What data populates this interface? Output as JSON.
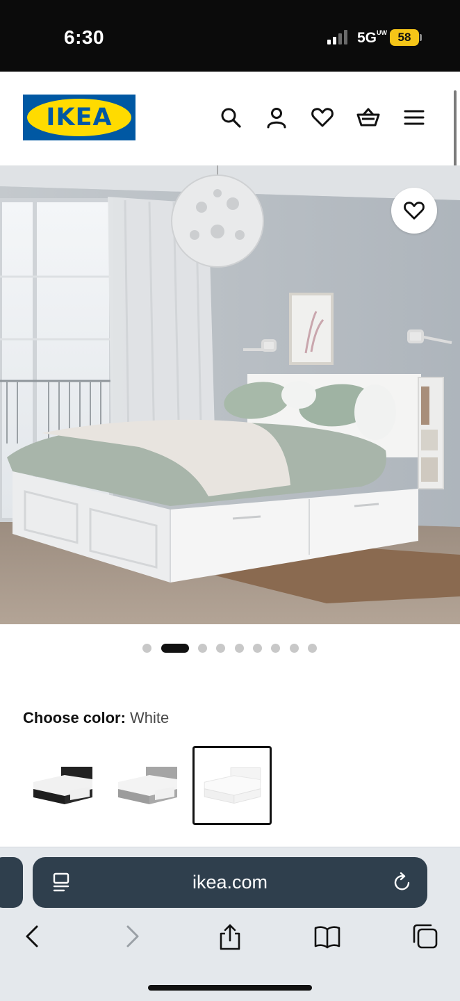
{
  "status_bar": {
    "time": "6:30",
    "network": "5G",
    "network_suffix": "UW",
    "battery": "58",
    "battery_color": "#f5c518"
  },
  "header": {
    "logo_text": "IKEA",
    "logo_colors": {
      "blue": "#0058a3",
      "yellow": "#ffdb00"
    },
    "icons": [
      "search-icon",
      "account-icon",
      "heart-icon",
      "basket-icon",
      "menu-icon"
    ]
  },
  "product": {
    "image_description_icon": "bed-photo",
    "favorite_icon": "heart-icon",
    "carousel": {
      "total": 9,
      "active_index": 1
    },
    "choose_color_label": "Choose color:",
    "selected_color": "White",
    "color_options": [
      {
        "name": "black",
        "color": "#1c1c1c"
      },
      {
        "name": "gray",
        "color": "#9a9a9a"
      },
      {
        "name": "white",
        "color": "#f2f2f2",
        "selected": true
      }
    ]
  },
  "browser": {
    "url": "ikea.com",
    "toolbar": [
      "back-icon",
      "forward-icon",
      "share-icon",
      "bookmarks-icon",
      "tabs-icon"
    ]
  }
}
